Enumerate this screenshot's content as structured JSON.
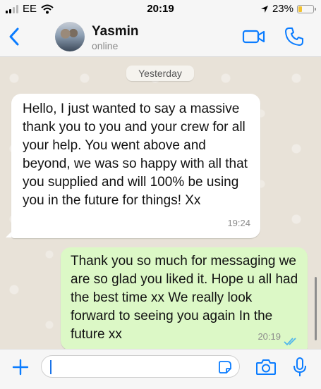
{
  "status_bar": {
    "carrier": "EE",
    "time": "20:19",
    "battery": "23%",
    "battery_level": 0.23
  },
  "header": {
    "contact_name": "Yasmin",
    "contact_status": "online",
    "icons": [
      "chevron-left-icon",
      "avatar",
      "video-camera-icon",
      "phone-icon"
    ],
    "accent_color": "#0a7cff"
  },
  "chat": {
    "date_separator": "Yesterday",
    "messages": [
      {
        "direction": "incoming",
        "text": "Hello, I just wanted to say a massive thank you to you and your crew for all your help. You went above and beyond, we was so happy with all that you supplied and will 100% be using you in the future for things! Xx",
        "time": "19:24"
      },
      {
        "direction": "outgoing",
        "text": "Thank you so much for messaging we are so glad you liked it. Hope u all had the best time xx We really look forward to seeing you again In the future xx",
        "time": "20:19",
        "status": "read"
      }
    ],
    "incoming_bg": "#ffffff",
    "outgoing_bg": "#dcf8c6"
  },
  "input_bar": {
    "placeholder": "",
    "icons": [
      "plus-icon",
      "sticker-icon",
      "camera-icon",
      "microphone-icon"
    ]
  }
}
